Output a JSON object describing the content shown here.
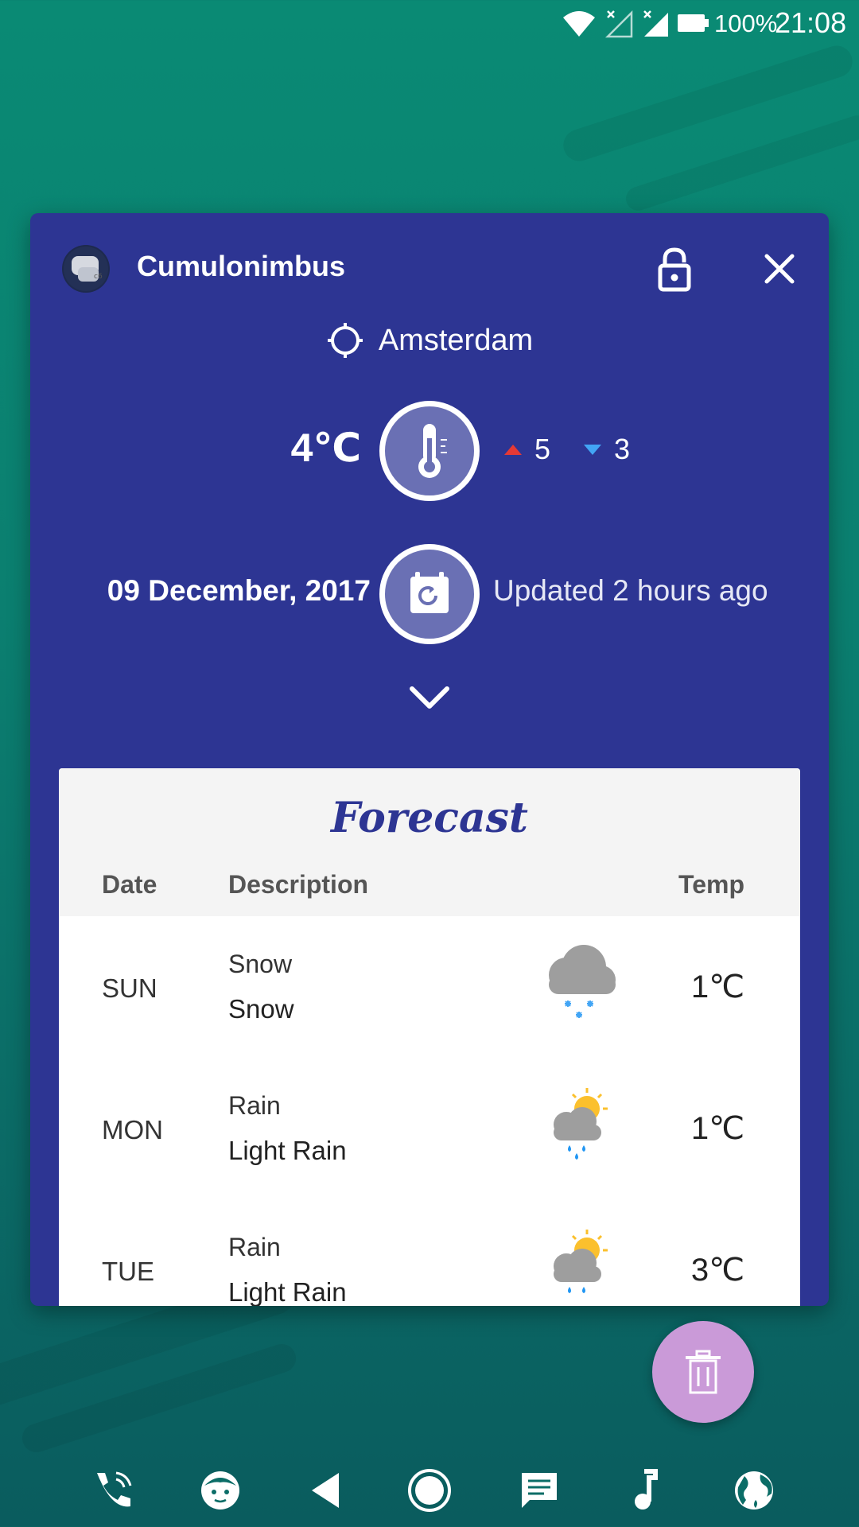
{
  "status_bar": {
    "battery": "100%",
    "time": "21:08",
    "icons": [
      "wifi-icon",
      "signal-off-icon",
      "signal-icon",
      "battery-icon"
    ]
  },
  "card": {
    "app_name": "Cumulonimbus",
    "app_icon": "cumulonimbus-app-icon",
    "location": "Amsterdam",
    "current_temp": "4℃",
    "temp_max": "5",
    "temp_min": "3",
    "date": "09 December, 2017",
    "updated": "Updated 2 hours ago",
    "icons": [
      "lock-icon",
      "close-icon",
      "location-target-icon",
      "thermometer-icon",
      "calendar-refresh-icon",
      "chevron-down-icon"
    ]
  },
  "forecast": {
    "title": "Forecast",
    "columns": {
      "date": "Date",
      "description": "Description",
      "temp": "Temp"
    },
    "rows": [
      {
        "day": "SUN",
        "main": "Snow",
        "desc": "Snow",
        "icon": "snow-cloud-icon",
        "temp": "1℃"
      },
      {
        "day": "MON",
        "main": "Rain",
        "desc": "Light Rain",
        "icon": "sun-rain-cloud-icon",
        "temp": "1℃"
      },
      {
        "day": "TUE",
        "main": "Rain",
        "desc": "Light Rain",
        "icon": "sun-rain-cloud-icon",
        "temp": "3℃"
      }
    ]
  },
  "fab": {
    "icon": "trash-icon"
  },
  "nav_bar": {
    "items": [
      "phone-icon",
      "face-icon",
      "back-icon",
      "home-icon",
      "message-icon",
      "music-icon",
      "globe-icon"
    ]
  },
  "colors": {
    "card_bg": "#2d3593",
    "accent_circle": "#6a70b4",
    "max_arrow": "#e53935",
    "min_arrow": "#42a5f5",
    "fab": "#ca9ad8",
    "wallpaper": "#0a8a74"
  }
}
